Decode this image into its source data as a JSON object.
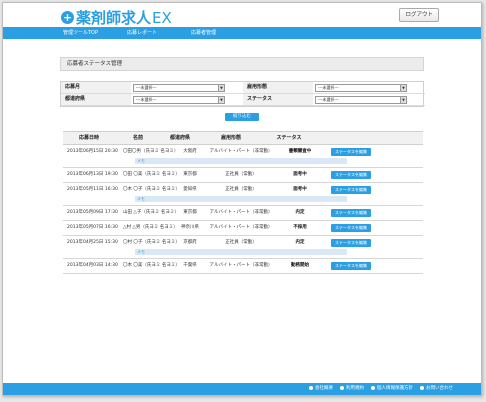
{
  "header": {
    "logo_mark": "+",
    "logo_text": "薬剤師求人",
    "logo_ex": "EX",
    "logout_label": "ログアウト"
  },
  "nav": {
    "items": [
      "管理ツールTOP",
      "応募レポート",
      "応募者管理"
    ]
  },
  "panel": {
    "title": "応募者ステータス管理",
    "filters": [
      {
        "label": "応募月",
        "value": "---未選択---"
      },
      {
        "label": "雇用形態",
        "value": "---未選択---"
      },
      {
        "label": "都道府県",
        "value": "---未選択---"
      },
      {
        "label": "ステータス",
        "value": "---未選択---"
      }
    ],
    "search_label": "絞り込む"
  },
  "table": {
    "headers": [
      "応募日時",
      "名前",
      "都道府県",
      "雇用形態",
      "ステータス",
      ""
    ],
    "edit_label": "ステータスを編集",
    "memo_label": "メモ",
    "rows": [
      {
        "date": "2013年06月15日 20:30",
        "name": "〇田〇男（氏ヨミ 名ヨミ）",
        "pref": "大阪府",
        "type": "アルバイト・パート（非常勤）",
        "status": "書類審査中",
        "memo": true
      },
      {
        "date": "2013年06月13日 19:30",
        "name": "〇田 〇美（氏ヨミ 名ヨミ）",
        "pref": "東京都",
        "type": "正社員（常勤）",
        "status": "面考中",
        "memo": false
      },
      {
        "date": "2013年05月11日 16:30",
        "name": "〇木 〇子（氏ヨミ 名ヨミ）",
        "pref": "愛知県",
        "type": "正社員（常勤）",
        "status": "面考中",
        "memo": true
      },
      {
        "date": "2013年05月09日 17:30",
        "name": "山田 △子（氏ヨミ 名ヨミ）",
        "pref": "東京都",
        "type": "アルバイト・パート（非常勤）",
        "status": "内定",
        "memo": false
      },
      {
        "date": "2013年05月07日 16:30",
        "name": "△村 △男（氏ヨミ 名ヨミ）",
        "pref": "神奈川県",
        "type": "アルバイト・パート（非常勤）",
        "status": "不採用",
        "memo": false
      },
      {
        "date": "2013年04月25日 15:30",
        "name": "〇村 〇子（氏ヨミ 名ヨミ）",
        "pref": "京都府",
        "type": "正社員（常勤）",
        "status": "内定",
        "memo": true
      },
      {
        "date": "2013年04月03日 14:30",
        "name": "〇木 〇美（氏ヨミ 名ヨミ）",
        "pref": "千葉県",
        "type": "アルバイト・パート（非常勤）",
        "status": "勤務開始",
        "memo": false
      }
    ]
  },
  "footer": {
    "links": [
      "会社概要",
      "利用規約",
      "個人情報保護方針",
      "お問い合わせ"
    ]
  }
}
